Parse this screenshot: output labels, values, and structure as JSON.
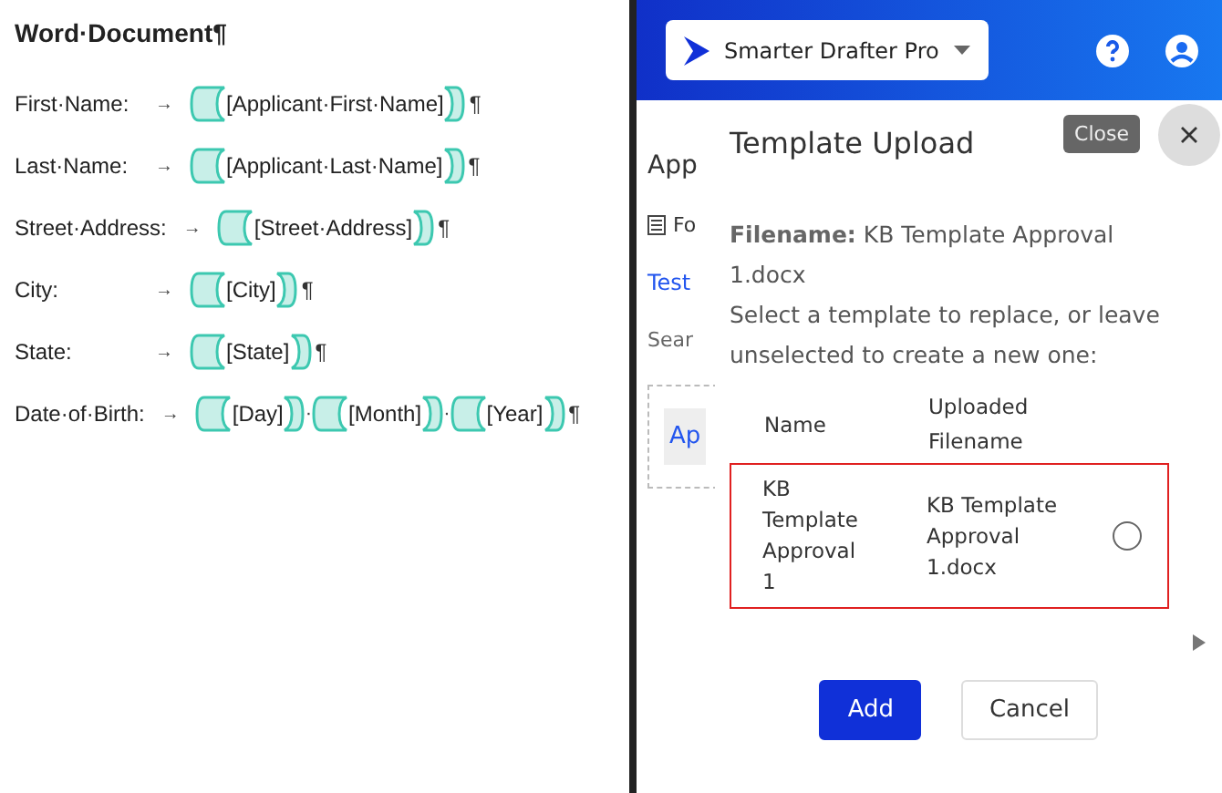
{
  "document": {
    "title": "Word·Document¶",
    "lines": [
      {
        "label": "First·Name:",
        "tab": "→",
        "fields": [
          "[Applicant·First·Name]"
        ],
        "mark": "¶"
      },
      {
        "label": "Last·Name:",
        "tab": "→",
        "fields": [
          "[Applicant·Last·Name]"
        ],
        "mark": "¶"
      },
      {
        "label": "Street·Address:",
        "tab": "→",
        "fields": [
          "[Street·Address]"
        ],
        "mark": "¶"
      },
      {
        "label": "City:",
        "tab": "→",
        "fields": [
          "[City]"
        ],
        "mark": "¶"
      },
      {
        "label": "State:",
        "tab": "→",
        "fields": [
          "[State]"
        ],
        "mark": "¶"
      },
      {
        "label": "Date·of·Birth:",
        "tab": "→",
        "fields": [
          "[Day]",
          "[Month]",
          "[Year]"
        ],
        "separators": [
          "·",
          "·"
        ],
        "mark": "¶"
      }
    ]
  },
  "app": {
    "product": "Smarter Drafter Pro",
    "background": {
      "heading": "App",
      "tab": "Fo",
      "link": "Test",
      "search": "Sear",
      "card": "Ap"
    }
  },
  "dialog": {
    "title": "Template Upload",
    "close_tooltip": "Close",
    "filename_label": "Filename:",
    "filename": "KB Template Approval 1.docx",
    "instruction": "Select a template to replace, or leave unselected to create a new one:",
    "columns": [
      "Name",
      "Uploaded Filename"
    ],
    "rows": [
      {
        "name": "KB Template Approval 1",
        "filename": "KB Template Approval 1.docx",
        "selected": false,
        "highlighted": true
      }
    ],
    "buttons": [
      {
        "label": "Add",
        "kind": "primary"
      },
      {
        "label": "Cancel",
        "kind": "secondary"
      }
    ]
  }
}
